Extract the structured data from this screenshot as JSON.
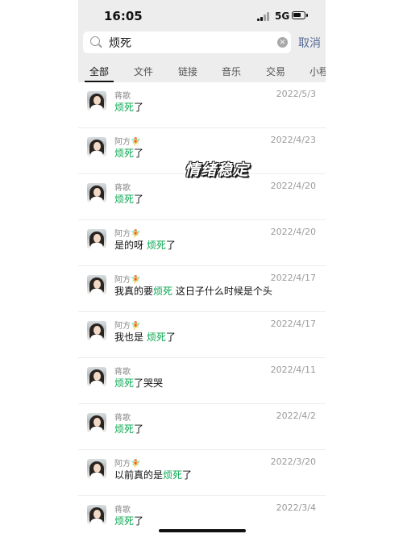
{
  "status": {
    "time": "16:05",
    "network": "5G"
  },
  "search": {
    "query": "烦死",
    "cancel_label": "取消",
    "clear_icon": "clear-circle-icon"
  },
  "tabs": [
    "全部",
    "文件",
    "链接",
    "音乐",
    "交易",
    "小程"
  ],
  "messages": [
    {
      "name": "蒋歌",
      "date": "2022/5/3",
      "pre": "",
      "hl": "烦死",
      "post": "了"
    },
    {
      "name": "阿方🧚",
      "date": "2022/4/23",
      "pre": "",
      "hl": "烦死",
      "post": "了"
    },
    {
      "name": "蒋歌",
      "date": "2022/4/20",
      "pre": "",
      "hl": "烦死",
      "post": "了"
    },
    {
      "name": "阿方🧚",
      "date": "2022/4/20",
      "pre": "是的呀 ",
      "hl": "烦死",
      "post": "了"
    },
    {
      "name": "阿方🧚",
      "date": "2022/4/17",
      "pre": "我真的要",
      "hl": "烦死",
      "post": " 这日子什么时候是个头"
    },
    {
      "name": "阿方🧚",
      "date": "2022/4/17",
      "pre": "我也是 ",
      "hl": "烦死",
      "post": "了"
    },
    {
      "name": "蒋歌",
      "date": "2022/4/11",
      "pre": "",
      "hl": "烦死",
      "post": "了哭哭"
    },
    {
      "name": "蒋歌",
      "date": "2022/4/2",
      "pre": "",
      "hl": "烦死",
      "post": "了"
    },
    {
      "name": "阿方🧚",
      "date": "2022/3/20",
      "pre": "以前真的是",
      "hl": "烦死",
      "post": "了"
    },
    {
      "name": "蒋歌",
      "date": "2022/3/4",
      "pre": "",
      "hl": "烦死",
      "post": "了"
    }
  ],
  "overlay_text": "情绪稳定",
  "colors": {
    "highlight": "#07a84f",
    "cancel": "#576b95",
    "header_bg": "#ededed"
  }
}
